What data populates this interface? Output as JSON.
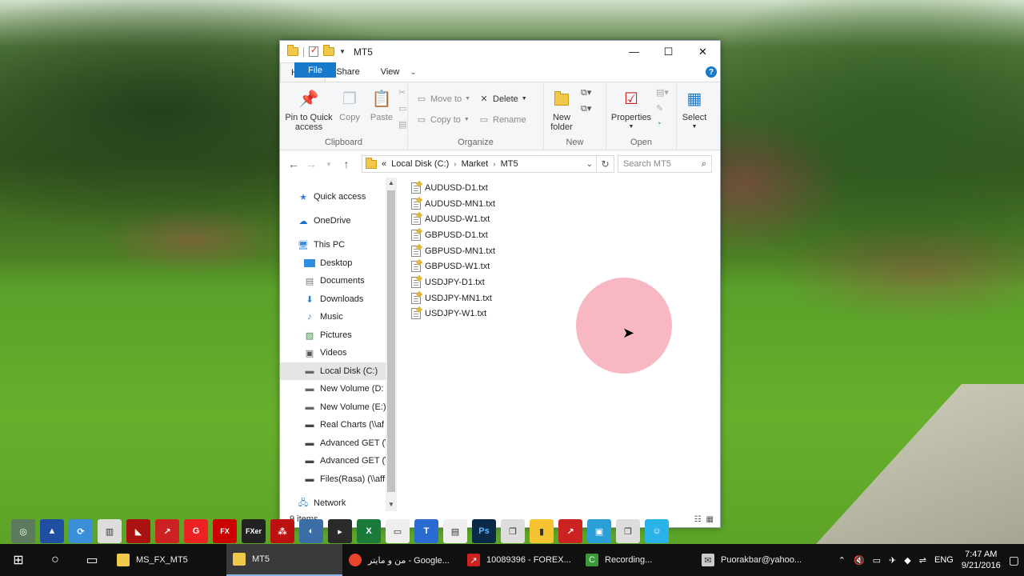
{
  "window": {
    "title": "MT5",
    "controls": {
      "minimize": "—",
      "maximize": "☐",
      "close": "✕"
    }
  },
  "tabs": [
    {
      "label": "File"
    },
    {
      "label": "Home"
    },
    {
      "label": "Share"
    },
    {
      "label": "View"
    }
  ],
  "ribbon": {
    "clipboard": {
      "label": "Clipboard",
      "pin": "Pin to Quick access",
      "copy": "Copy",
      "paste": "Paste"
    },
    "organize": {
      "label": "Organize",
      "move_to": "Move to",
      "copy_to": "Copy to",
      "delete": "Delete",
      "rename": "Rename"
    },
    "new": {
      "label": "New",
      "new_folder": "New folder"
    },
    "open": {
      "label": "Open",
      "properties": "Properties"
    },
    "select": {
      "label": "Select"
    }
  },
  "address": {
    "prefix": "«",
    "crumbs": [
      "Local Disk (C:)",
      "Market",
      "MT5"
    ],
    "search_placeholder": "Search MT5"
  },
  "nav": {
    "items": [
      {
        "label": "Quick access",
        "icon": "star-icon"
      },
      {
        "label": "OneDrive",
        "icon": "cloud-icon"
      },
      {
        "label": "This PC",
        "icon": "computer-icon"
      },
      {
        "label": "Desktop",
        "icon": "desktop-icon"
      },
      {
        "label": "Documents",
        "icon": "documents-icon"
      },
      {
        "label": "Downloads",
        "icon": "download-icon"
      },
      {
        "label": "Music",
        "icon": "music-icon"
      },
      {
        "label": "Pictures",
        "icon": "pictures-icon"
      },
      {
        "label": "Videos",
        "icon": "videos-icon"
      },
      {
        "label": "Local Disk (C:)",
        "icon": "drive-icon"
      },
      {
        "label": "New Volume (D:",
        "icon": "drive-icon"
      },
      {
        "label": "New Volume (E:)",
        "icon": "drive-icon"
      },
      {
        "label": "Real Charts (\\\\af",
        "icon": "network-drive-icon"
      },
      {
        "label": "Advanced GET (\\",
        "icon": "network-drive-icon"
      },
      {
        "label": "Advanced GET (\\",
        "icon": "network-drive-icon"
      },
      {
        "label": "Files(Rasa) (\\\\aff",
        "icon": "network-drive-icon"
      },
      {
        "label": "Network",
        "icon": "network-icon"
      }
    ]
  },
  "files": [
    "AUDUSD-D1.txt",
    "AUDUSD-MN1.txt",
    "AUDUSD-W1.txt",
    "GBPUSD-D1.txt",
    "GBPUSD-MN1.txt",
    "GBPUSD-W1.txt",
    "USDJPY-D1.txt",
    "USDJPY-MN1.txt",
    "USDJPY-W1.txt"
  ],
  "status": {
    "count": "9 items"
  },
  "taskbar": {
    "apps": [
      {
        "label": "MS_FX_MT5"
      },
      {
        "label": "MT5"
      },
      {
        "label": "من و مایتر - Google..."
      },
      {
        "label": "10089396 - FOREX..."
      },
      {
        "label": "Recording..."
      },
      {
        "label": "Puorakbar@yahoo..."
      }
    ],
    "lang": "ENG",
    "time": "7:47 AM",
    "date": "9/21/2016"
  },
  "colors": {
    "accent": "#1979ca",
    "folder": "#f0c94a",
    "taskbar": "#101010"
  }
}
